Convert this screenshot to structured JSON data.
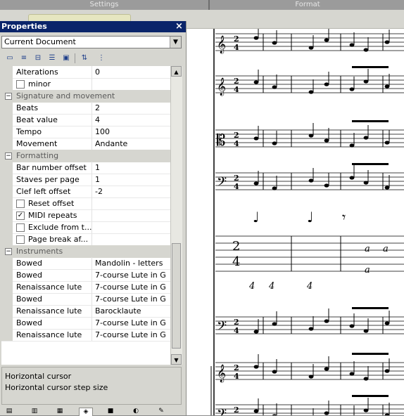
{
  "top": {
    "settings_label": "Settings",
    "format_label": "Format"
  },
  "panel": {
    "title": "Properties",
    "close_glyph": "×",
    "combo_value": "Current Document",
    "combo_arrow": "▼",
    "toolbar_icons": [
      "page-icon",
      "list-icon",
      "tree-icon",
      "outline-icon",
      "layout-icon",
      "sort-az-icon",
      "options-icon"
    ],
    "rows": [
      {
        "type": "prop",
        "name": "Alterations",
        "value": "0"
      },
      {
        "type": "check",
        "name": "minor",
        "checked": false,
        "mark": ""
      },
      {
        "type": "cat",
        "name": "Signature and movement",
        "toggle": "−"
      },
      {
        "type": "prop",
        "name": "Beats",
        "value": "2"
      },
      {
        "type": "prop",
        "name": "Beat value",
        "value": "4"
      },
      {
        "type": "prop",
        "name": "Tempo",
        "value": "100"
      },
      {
        "type": "prop",
        "name": "Movement",
        "value": "Andante"
      },
      {
        "type": "cat",
        "name": "Formatting",
        "toggle": "−"
      },
      {
        "type": "prop",
        "name": "Bar number offset",
        "value": "1"
      },
      {
        "type": "prop",
        "name": "Staves per page",
        "value": "1"
      },
      {
        "type": "prop",
        "name": "Clef left offset",
        "value": "-2"
      },
      {
        "type": "check",
        "name": "Reset offset",
        "checked": false,
        "mark": ""
      },
      {
        "type": "check",
        "name": "MIDI repeats",
        "checked": true,
        "mark": "✓"
      },
      {
        "type": "check",
        "name": "Exclude from t...",
        "checked": false,
        "mark": ""
      },
      {
        "type": "check",
        "name": "Page break af...",
        "checked": false,
        "mark": ""
      },
      {
        "type": "cat",
        "name": "Instruments",
        "toggle": "−"
      },
      {
        "type": "prop",
        "name": "Bowed",
        "value": "Mandolin - letters"
      },
      {
        "type": "prop",
        "name": "Bowed",
        "value": "7-course Lute in G"
      },
      {
        "type": "prop",
        "name": "Renaissance lute",
        "value": "7-course Lute in G"
      },
      {
        "type": "prop",
        "name": "Bowed",
        "value": "7-course Lute in G"
      },
      {
        "type": "prop",
        "name": "Renaissance lute",
        "value": "Barocklaute"
      },
      {
        "type": "prop",
        "name": "Bowed",
        "value": "7-course Lute in G"
      },
      {
        "type": "prop",
        "name": "Renaissance lute",
        "value": "7-course Lute in G"
      }
    ],
    "scroll_up": "▲",
    "scroll_down": "▼",
    "help_title": "Horizontal cursor",
    "help_text": "Horizontal cursor step size",
    "bottom_tabs": [
      "files-tab-icon",
      "document-tab-icon",
      "layers-tab-icon",
      "properties-tab-icon",
      "colors-tab-icon",
      "palette-tab-icon",
      "tools-tab-icon"
    ]
  },
  "score": {
    "time_signature": {
      "beats": "2",
      "beat_value": "4"
    },
    "tab_letters": [
      "a",
      "a",
      "a"
    ],
    "tab_numbers": [
      "4",
      "4",
      "4"
    ],
    "rhythm_flags": [
      "♩",
      "♩",
      "𝄾"
    ]
  },
  "colors": {
    "title_bar": "#0a246a",
    "panel_bg": "#d6d6d0",
    "accent": "#1f3f8a"
  }
}
